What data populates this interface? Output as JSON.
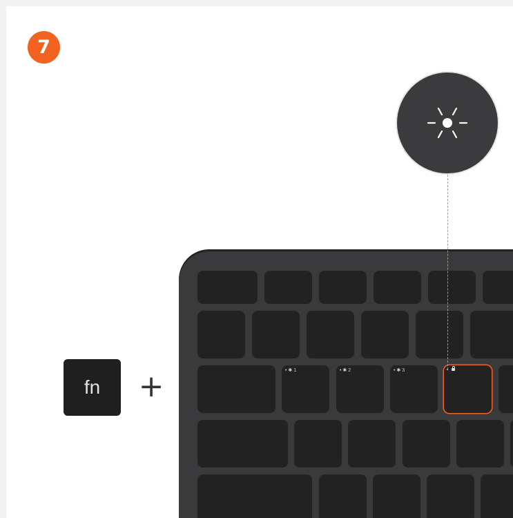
{
  "step": {
    "number": "7"
  },
  "modifier_key": {
    "label": "fn"
  },
  "combine_symbol": "+",
  "callout": {
    "icon": "brightness-icon"
  },
  "keyboard": {
    "row3_key_labels": [
      "• ✱ 1",
      "• ✱ 2",
      "• ✱ 3"
    ],
    "highlighted_key_icon": "lock-icon"
  },
  "colors": {
    "accent": "#f26322",
    "key": "#222222",
    "keyboard_body": "#3a3a3c",
    "callout": "#3b3b3d"
  }
}
